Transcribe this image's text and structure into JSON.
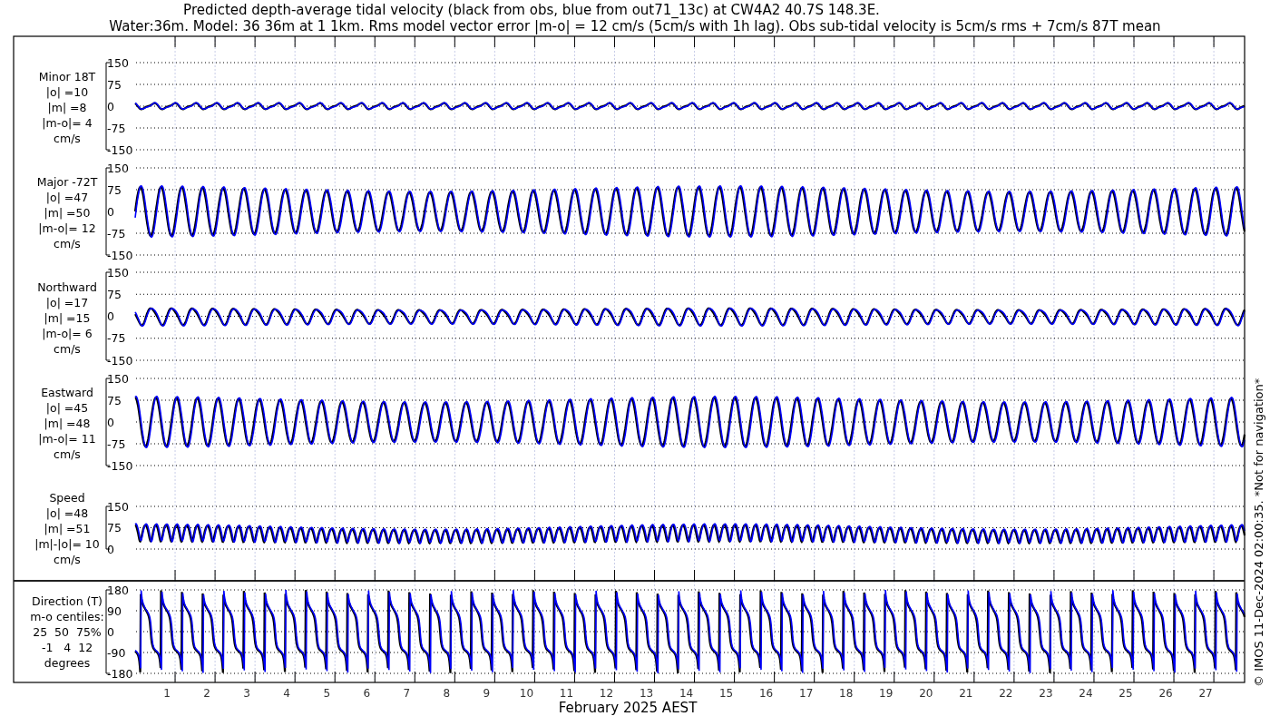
{
  "title_lines": [
    "Predicted depth-average tidal velocity (black from obs, blue from out71_13c) at CW4A2 40.7S 148.3E.",
    "Water:36m. Model: 36 36m at 1 1km. Rms model vector error |m-o| = 12 cm/s (5cm/s with 1h lag). Obs sub-tidal velocity is 5cm/s rms + 7cm/s 87T mean"
  ],
  "panels": [
    {
      "kind": "signed",
      "label_lines": [
        "Minor 18T",
        "|o| =10",
        "|m| =8",
        "|m-o|= 4",
        "cm/s"
      ],
      "yticks": [
        "150",
        "75",
        "0",
        "-75",
        "-150"
      ]
    },
    {
      "kind": "signed",
      "label_lines": [
        "Major -72T",
        "|o| =47",
        "|m| =50",
        "|m-o|= 12",
        "cm/s"
      ],
      "yticks": [
        "150",
        "75",
        "0",
        "-75",
        "-150"
      ]
    },
    {
      "kind": "signed",
      "label_lines": [
        "Northward",
        "|o| =17",
        "|m| =15",
        "|m-o|= 6",
        "cm/s"
      ],
      "yticks": [
        "150",
        "75",
        "0",
        "-75",
        "-150"
      ]
    },
    {
      "kind": "signed",
      "label_lines": [
        "Eastward",
        "|o| =45",
        "|m| =48",
        "|m-o|= 11",
        "cm/s"
      ],
      "yticks": [
        "150",
        "75",
        "0",
        "-75",
        "-150"
      ]
    },
    {
      "kind": "speed",
      "label_lines": [
        "Speed",
        "|o| =48",
        "|m| =51",
        "|m|-|o|= 10",
        "cm/s"
      ],
      "yticks": [
        "150",
        "75",
        "0"
      ]
    },
    {
      "kind": "direction",
      "label_lines": [
        "Direction (T)",
        "m-o centiles:",
        "25  50  75%",
        "-1   4  12",
        "degrees"
      ],
      "yticks": [
        "180",
        "90",
        "0",
        "-90",
        "-180"
      ]
    }
  ],
  "xticks": [
    "1",
    "2",
    "3",
    "4",
    "5",
    "6",
    "7",
    "8",
    "9",
    "10",
    "11",
    "12",
    "13",
    "14",
    "15",
    "16",
    "17",
    "18",
    "19",
    "20",
    "21",
    "22",
    "23",
    "24",
    "25",
    "26",
    "27"
  ],
  "xlabel": "February 2025 AEST",
  "footer": "© IMOS 11-Dec-2024 02:00:35. *Not for navigation*"
}
